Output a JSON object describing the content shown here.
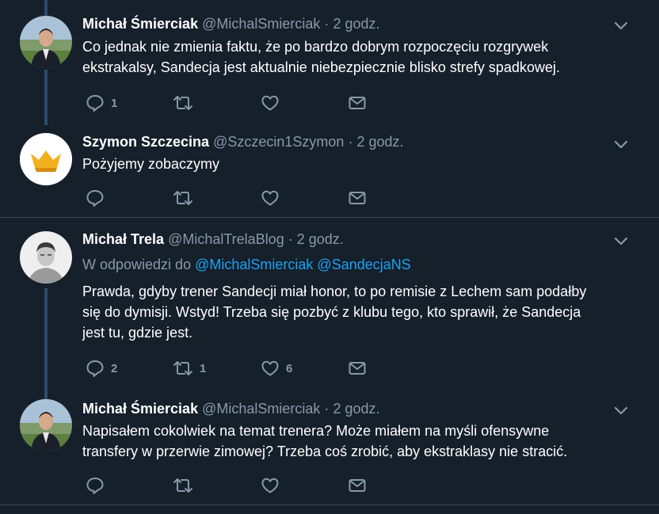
{
  "tweets": [
    {
      "name": "Michał Śmierciak",
      "handle": "@MichalSmierciak",
      "dot": "·",
      "time": "2 godz.",
      "text_lines": [
        "Co jednak nie zmienia faktu, że po bardzo dobrym rozpoczęciu rozgrywek",
        "ekstrakalsy, Sandecja jest aktualnie niebezpiecznie blisko strefy spadkowej."
      ],
      "reply_count": "1",
      "retweet_count": "",
      "like_count": ""
    },
    {
      "name": "Szymon Szczecina",
      "handle": "@Szczecin1Szymon",
      "dot": "·",
      "time": "2 godz.",
      "text_lines": [
        "Pożyjemy zobaczymy"
      ],
      "reply_count": "",
      "retweet_count": "",
      "like_count": ""
    },
    {
      "name": "Michał Trela",
      "handle": "@MichalTrelaBlog",
      "dot": "·",
      "time": "2 godz.",
      "reply_prefix": "W odpowiedzi do",
      "reply_mentions": [
        "@MichalSmierciak",
        "@SandecjaNS"
      ],
      "text_lines": [
        "Prawda, gdyby trener Sandecji miał honor, to po remisie z Lechem sam podałby",
        "się do dymisji. Wstyd! Trzeba się pozbyć z klubu tego, kto sprawił, że Sandecja",
        "jest tu, gdzie jest."
      ],
      "reply_count": "2",
      "retweet_count": "1",
      "like_count": "6"
    },
    {
      "name": "Michał Śmierciak",
      "handle": "@MichalSmierciak",
      "dot": "·",
      "time": "2 godz.",
      "text_lines": [
        "Napisałem cokolwiek na temat trenera? Może miałem na myśli ofensywne",
        "transfery w przerwie zimowej? Trzeba coś zrobić, aby ekstraklasy nie stracić."
      ],
      "reply_count": "",
      "retweet_count": "",
      "like_count": ""
    }
  ],
  "icons": {
    "more": "chevron-down-icon",
    "reply": "reply-icon",
    "retweet": "retweet-icon",
    "like": "heart-icon",
    "message": "envelope-icon"
  },
  "colors": {
    "background": "#15202b",
    "secondary_text": "#8899a6",
    "mention": "#1da1f2",
    "thread_line": "#2a4d6e",
    "separator": "#38444d"
  }
}
